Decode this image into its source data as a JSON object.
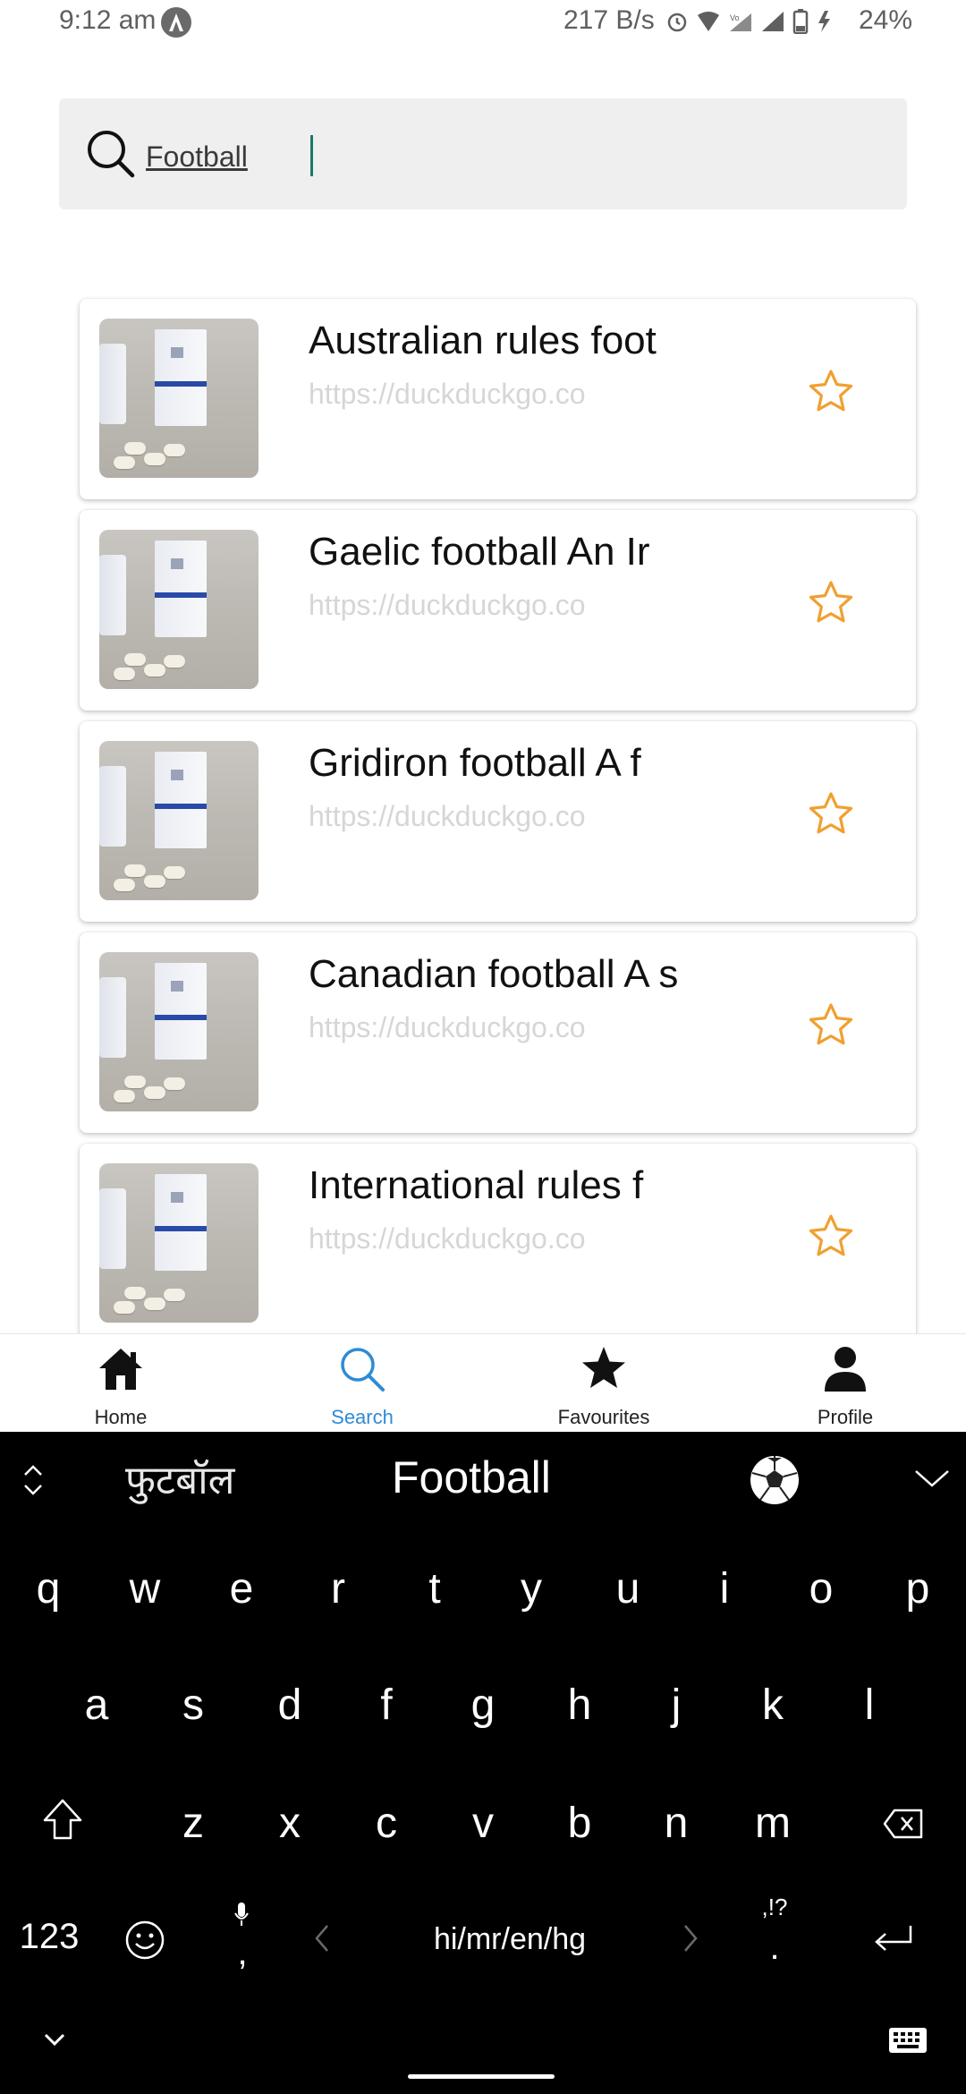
{
  "status_bar": {
    "time": "9:12 am",
    "network_speed": "217 B/s",
    "battery": "24%"
  },
  "search": {
    "value": "Football"
  },
  "results": [
    {
      "title": "Australian rules foot",
      "url": "https://duckduckgo.co"
    },
    {
      "title": "Gaelic football An Ir",
      "url": "https://duckduckgo.co"
    },
    {
      "title": "Gridiron football A f",
      "url": "https://duckduckgo.co"
    },
    {
      "title": "Canadian football A s",
      "url": "https://duckduckgo.co"
    },
    {
      "title": "International rules f",
      "url": "https://duckduckgo.co"
    }
  ],
  "bottom_nav": {
    "items": [
      {
        "label": "Home",
        "icon": "home-icon"
      },
      {
        "label": "Search",
        "icon": "search-icon",
        "active": true
      },
      {
        "label": "Favourites",
        "icon": "star-icon"
      },
      {
        "label": "Profile",
        "icon": "person-icon"
      }
    ]
  },
  "keyboard": {
    "suggestions": [
      "फुटबॉल",
      "Football",
      "⚽"
    ],
    "row1": [
      "q",
      "w",
      "e",
      "r",
      "t",
      "y",
      "u",
      "i",
      "o",
      "p"
    ],
    "row2": [
      "a",
      "s",
      "d",
      "f",
      "g",
      "h",
      "j",
      "k",
      "l"
    ],
    "row3": [
      "z",
      "x",
      "c",
      "v",
      "b",
      "n",
      "m"
    ],
    "numbers_key": "123",
    "comma_key": ",",
    "language_key": "hi/mr/en/hg",
    "punct_key_top": ",!?",
    "punct_key_bottom": "."
  },
  "colors": {
    "accent_blue": "#2f8bd4",
    "star_orange": "#f0a030",
    "search_bg": "#efefef"
  }
}
